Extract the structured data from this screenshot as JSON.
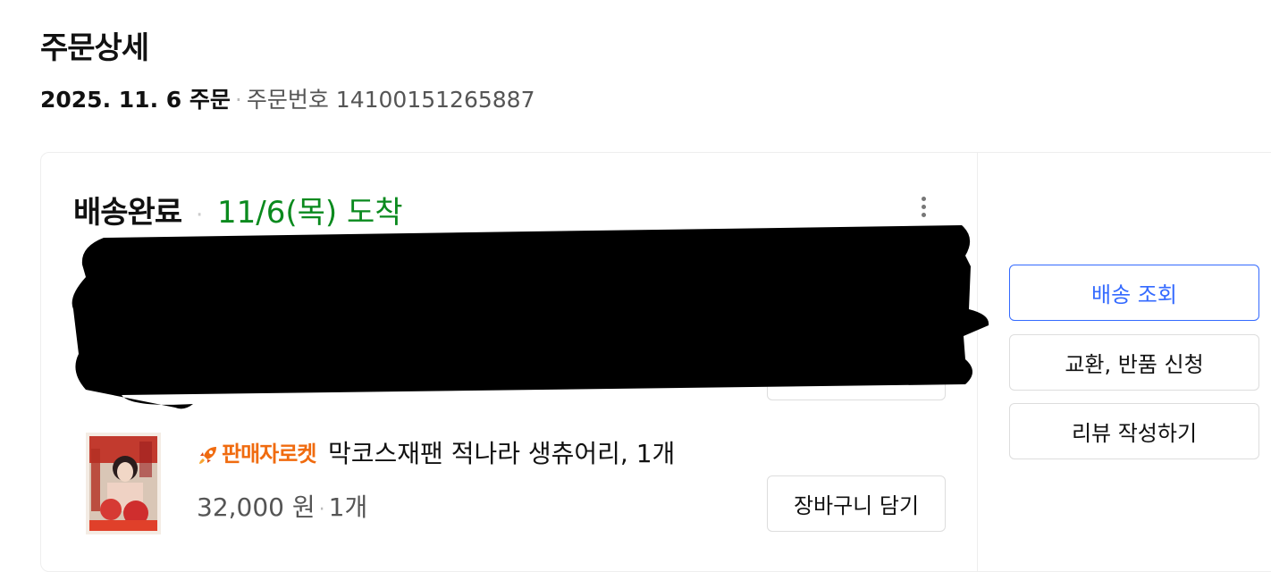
{
  "page": {
    "title": "주문상세"
  },
  "order": {
    "date": "2025. 11. 6 주문",
    "separator": "·",
    "number_label": "주문번호",
    "number": "14100151265887"
  },
  "shipment": {
    "status": "배송완료",
    "separator": "·",
    "arrival": "11/6(목) 도착"
  },
  "product": {
    "badge": "판매자로켓",
    "name": "막코스재팬 적나라 생츄어리, 1개",
    "price": "32,000 원",
    "separator": "·",
    "quantity": "1개",
    "cart_button": "장바구니 담기"
  },
  "actions": {
    "track": "배송 조회",
    "return": "교환, 반품 신청",
    "review": "리뷰 작성하기"
  },
  "colors": {
    "arrival_green": "#0a8a1e",
    "rocket_orange": "#f06b0f",
    "primary_blue": "#346aff"
  }
}
